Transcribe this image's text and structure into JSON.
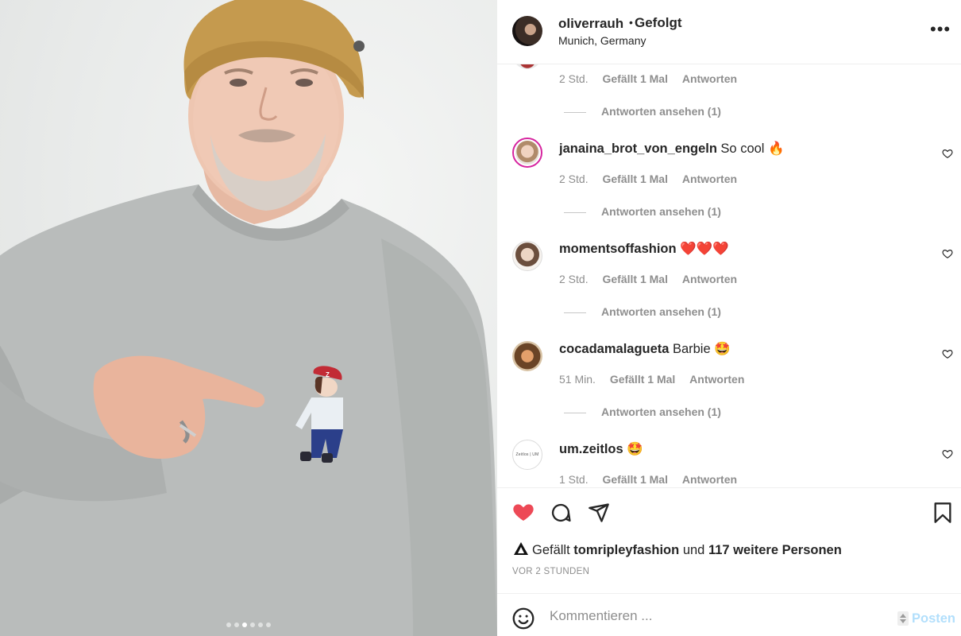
{
  "post": {
    "username": "oliverrauh",
    "separator": "•",
    "follow_status": "Gefolgt",
    "location": "Munich, Germany",
    "more_icon": "more-horizontal-icon"
  },
  "carousel": {
    "count": 6,
    "active_index": 2
  },
  "comments": {
    "partial": {
      "time": "2 Std.",
      "likes": "Gefällt 1 Mal",
      "reply": "Antworten",
      "view_replies": "Antworten ansehen (1)"
    },
    "items": [
      {
        "username": "janaina_brot_von_engeln",
        "text": "So cool 🔥",
        "time": "2 Std.",
        "likes": "Gefällt 1 Mal",
        "reply": "Antworten",
        "view_replies": "Antworten ansehen (1)"
      },
      {
        "username": "momentsoffashion",
        "text": "❤️❤️❤️",
        "time": "2 Std.",
        "likes": "Gefällt 1 Mal",
        "reply": "Antworten",
        "view_replies": "Antworten ansehen (1)"
      },
      {
        "username": "cocadamalagueta",
        "text": "Barbie 🤩",
        "time": "51 Min.",
        "likes": "Gefällt 1 Mal",
        "reply": "Antworten",
        "view_replies": "Antworten ansehen (1)"
      },
      {
        "username": "um.zeitlos",
        "text": "🤩",
        "time": "1 Std.",
        "likes": "Gefällt 1 Mal",
        "reply": "Antworten",
        "avatar_text": "Zeitlos | UM"
      }
    ]
  },
  "actions": {
    "like_icon": "heart-filled-icon",
    "comment_icon": "comment-icon",
    "share_icon": "paper-plane-icon",
    "save_icon": "bookmark-icon",
    "liked": true,
    "like_color": "#ed4956"
  },
  "likes": {
    "prefix": "Gefällt",
    "user": "tomripleyfashion",
    "middle": "und",
    "others": "117 weitere Personen"
  },
  "timestamp": "VOR 2 STUNDEN",
  "composer": {
    "placeholder": "Kommentieren ...",
    "post_label": "Posten",
    "emoji_icon": "smiley-icon"
  }
}
